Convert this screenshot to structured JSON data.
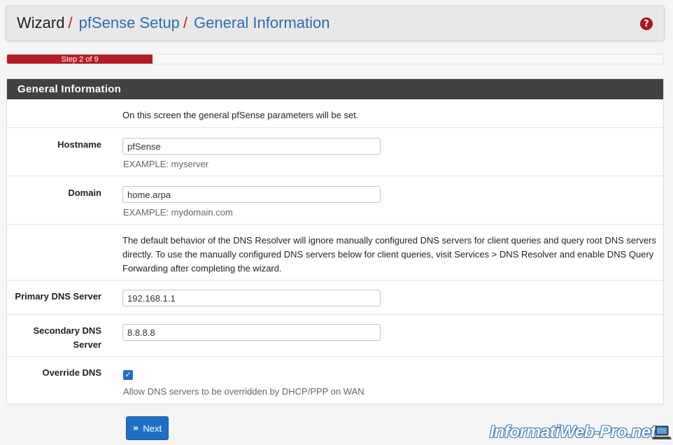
{
  "breadcrumb": {
    "root": "Wizard",
    "separator": "/",
    "level1": "pfSense Setup",
    "level2": "General Information"
  },
  "help_icon": "question-circle-icon",
  "progress": {
    "label": "Step 2 of 9",
    "fraction": 0.222
  },
  "panel": {
    "title": "General Information",
    "intro": "On this screen the general pfSense parameters will be set.",
    "hostname": {
      "label": "Hostname",
      "value": "pfSense",
      "hint": "EXAMPLE: myserver"
    },
    "domain": {
      "label": "Domain",
      "value": "home.arpa",
      "hint": "EXAMPLE: mydomain.com"
    },
    "dns_note": "The default behavior of the DNS Resolver will ignore manually configured DNS servers for client queries and query root DNS servers directly. To use the manually configured DNS servers below for client queries, visit Services > DNS Resolver and enable DNS Query Forwarding after completing the wizard.",
    "primary_dns": {
      "label": "Primary DNS Server",
      "value": "192.168.1.1"
    },
    "secondary_dns": {
      "label": "Secondary DNS Server",
      "value": "8.8.8.8"
    },
    "override_dns": {
      "label": "Override DNS",
      "checked": true,
      "hint": "Allow DNS servers to be overridden by DHCP/PPP on WAN"
    }
  },
  "next_button": {
    "label": "Next",
    "icon": "double-chevron-right-icon"
  },
  "watermark": "InformatiWeb-Pro.net",
  "colors": {
    "accent_red": "#b81c22",
    "link_blue": "#2a6eb0",
    "button_blue": "#1f6fc6",
    "panel_header": "#424242"
  }
}
